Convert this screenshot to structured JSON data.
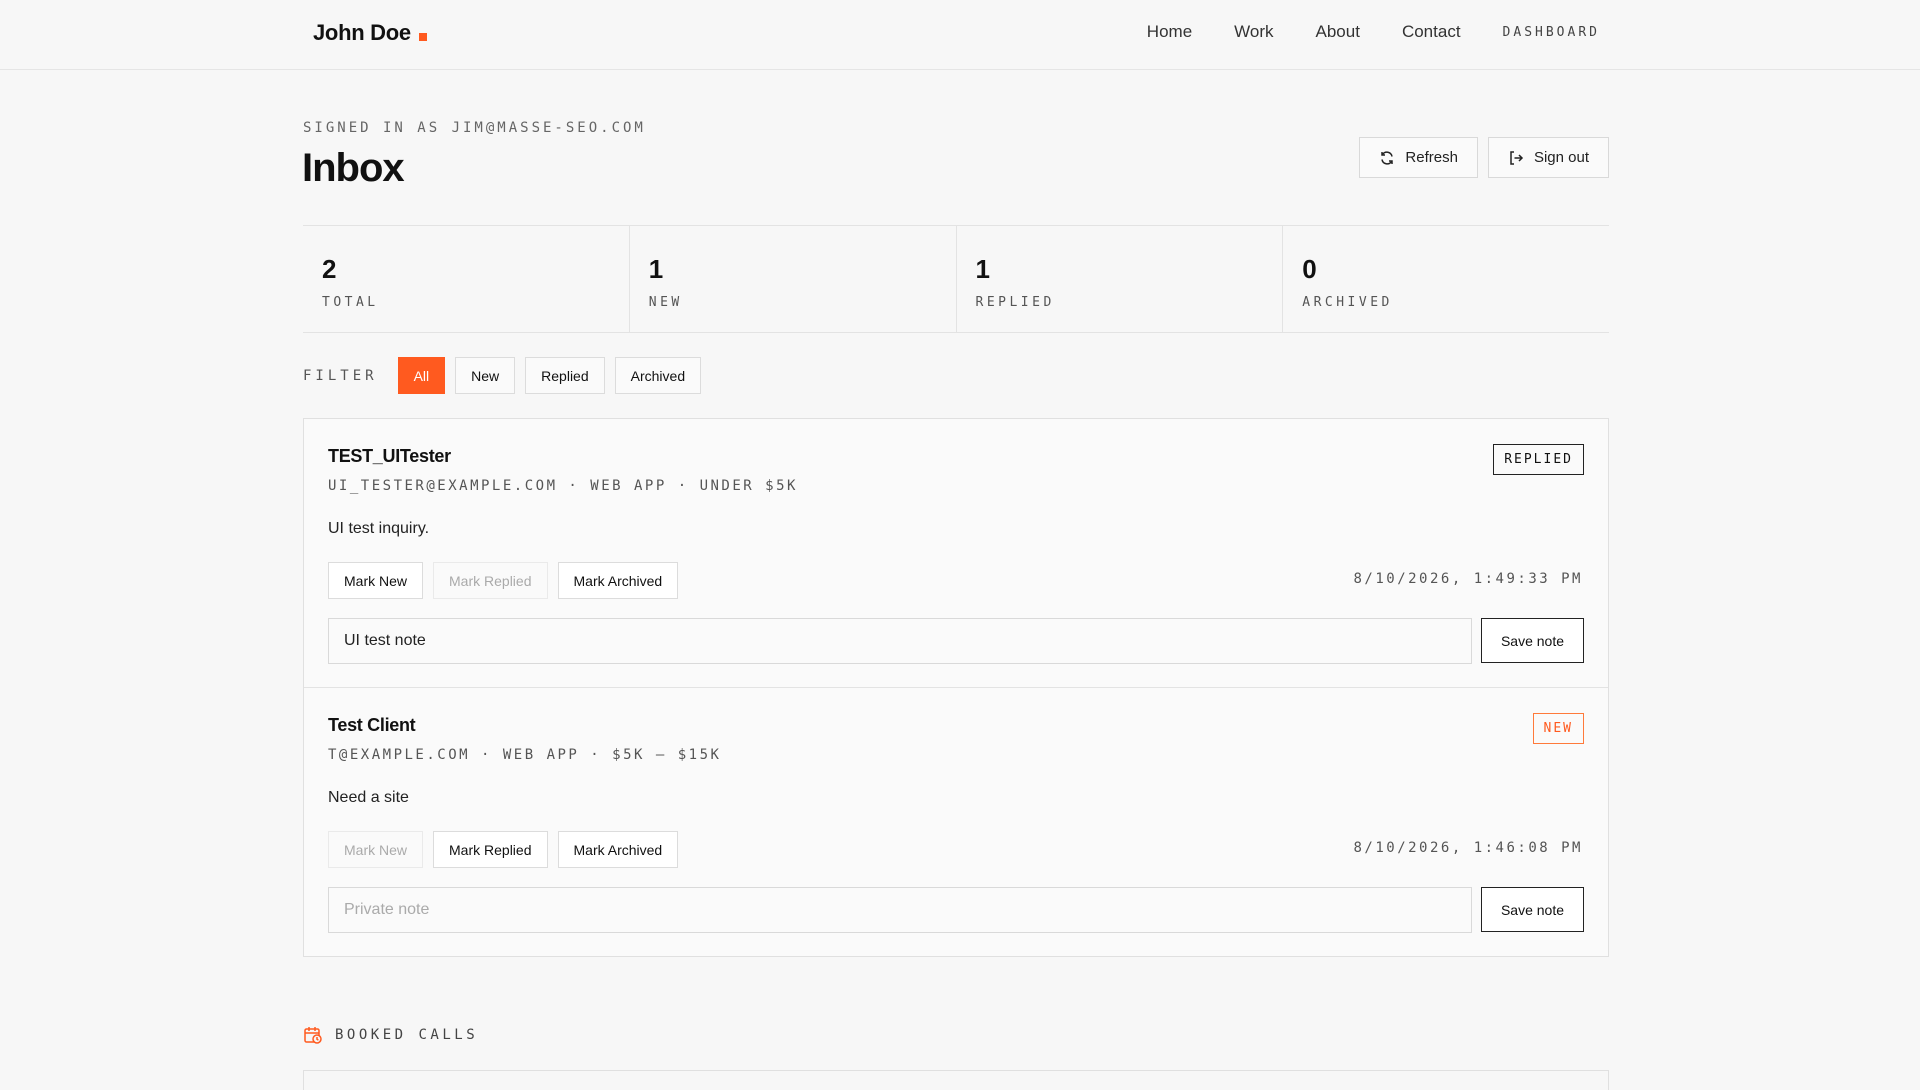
{
  "nav": {
    "brand": "John Doe",
    "links": [
      "Home",
      "Work",
      "About",
      "Contact"
    ],
    "dashboard": "DASHBOARD",
    "accent": "#ff5a1f"
  },
  "header": {
    "signed_in": "SIGNED IN AS JIM@MASSE-SEO.COM",
    "title": "Inbox",
    "refresh": "Refresh",
    "sign_out": "Sign out"
  },
  "stats": [
    {
      "value": "2",
      "label": "TOTAL"
    },
    {
      "value": "1",
      "label": "NEW"
    },
    {
      "value": "1",
      "label": "REPLIED"
    },
    {
      "value": "0",
      "label": "ARCHIVED"
    }
  ],
  "filter": {
    "label": "FILTER",
    "options": [
      "All",
      "New",
      "Replied",
      "Archived"
    ],
    "selected": "All"
  },
  "inquiries": [
    {
      "name": "TEST_UITester",
      "meta": "UI_TESTER@EXAMPLE.COM · WEB APP · UNDER $5K",
      "message": "UI test inquiry.",
      "status": "REPLIED",
      "actions": [
        "Mark New",
        "Mark Replied",
        "Mark Archived"
      ],
      "timestamp": "8/10/2026, 1:49:33 PM",
      "note_value": "UI test note",
      "note_placeholder": "Private note",
      "save": "Save note"
    },
    {
      "name": "Test Client",
      "meta": "T@EXAMPLE.COM · WEB APP · $5K – $15K",
      "message": "Need a site",
      "status": "NEW",
      "actions": [
        "Mark New",
        "Mark Replied",
        "Mark Archived"
      ],
      "timestamp": "8/10/2026, 1:46:08 PM",
      "note_value": "",
      "note_placeholder": "Private note",
      "save": "Save note"
    }
  ],
  "booked": {
    "label": "BOOKED CALLS",
    "icon": "calendar-clock-icon"
  }
}
